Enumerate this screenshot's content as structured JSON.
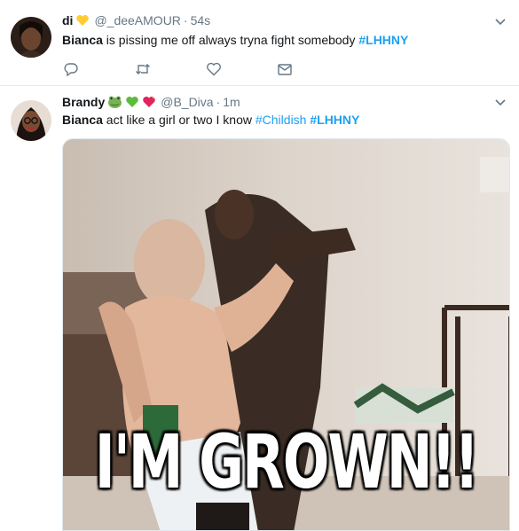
{
  "tweets": [
    {
      "name": "di",
      "emojis": [
        "yellow-heart"
      ],
      "handle": "@_deeAMOUR",
      "dot": "·",
      "time": "54s",
      "text_mention": "Bianca",
      "text_body": " is pissing me off  always tryna fight somebody ",
      "hashtag1": "#LHHNY",
      "actions": [
        "reply-icon",
        "retweet-icon",
        "like-icon",
        "direct-message-icon"
      ]
    },
    {
      "name": "Brandy",
      "emojis": [
        "frog-face",
        "green-heart",
        "sparkling-heart"
      ],
      "handle": "@B_Diva",
      "dot": "·",
      "time": "1m",
      "text_mention": "Bianca",
      "text_body": " act like a girl or two I know ",
      "hashtag1": "#Childish",
      "hashtag2": "#LHHNY",
      "media": {
        "caption": "I'M GROWN!!"
      }
    }
  ],
  "colors": {
    "link": "#1da1f2",
    "secondary": "#657786",
    "border": "#e6ecf0"
  }
}
